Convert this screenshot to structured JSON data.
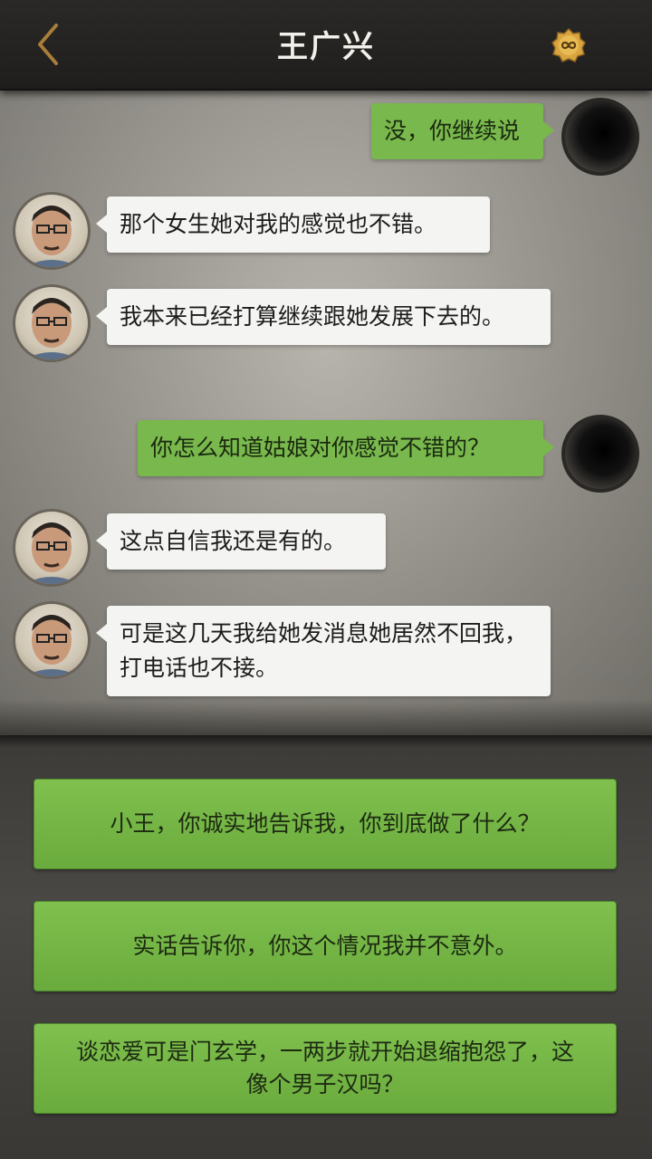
{
  "header": {
    "title": "王广兴",
    "back_icon": "chevron-left-icon",
    "menu_icon": "infinity-badge-icon",
    "accent_color": "#b0823c"
  },
  "messages": [
    {
      "side": "right",
      "text": "没，你继续说"
    },
    {
      "side": "left",
      "text": "那个女生她对我的感觉也不错。"
    },
    {
      "side": "left",
      "text": "我本来已经打算继续跟她发展下去的。"
    },
    {
      "side": "right",
      "text": "你怎么知道姑娘对你感觉不错的？"
    },
    {
      "side": "left",
      "text": "这点自信我还是有的。"
    },
    {
      "side": "left",
      "text": "可是这几天我给她发消息她居然不回我，打电话也不接。"
    }
  ],
  "options": [
    {
      "text": "小王，你诚实地告诉我，你到底做了什么？"
    },
    {
      "text": "实话告诉你，你这个情况我并不意外。"
    },
    {
      "text": "谈恋爱可是门玄学，一两步就开始退缩抱怨了，这像个男子汉吗？"
    }
  ],
  "colors": {
    "bubble_right": "#79b84c",
    "bubble_left": "#f4f4f2",
    "option_green": "#74b646"
  }
}
